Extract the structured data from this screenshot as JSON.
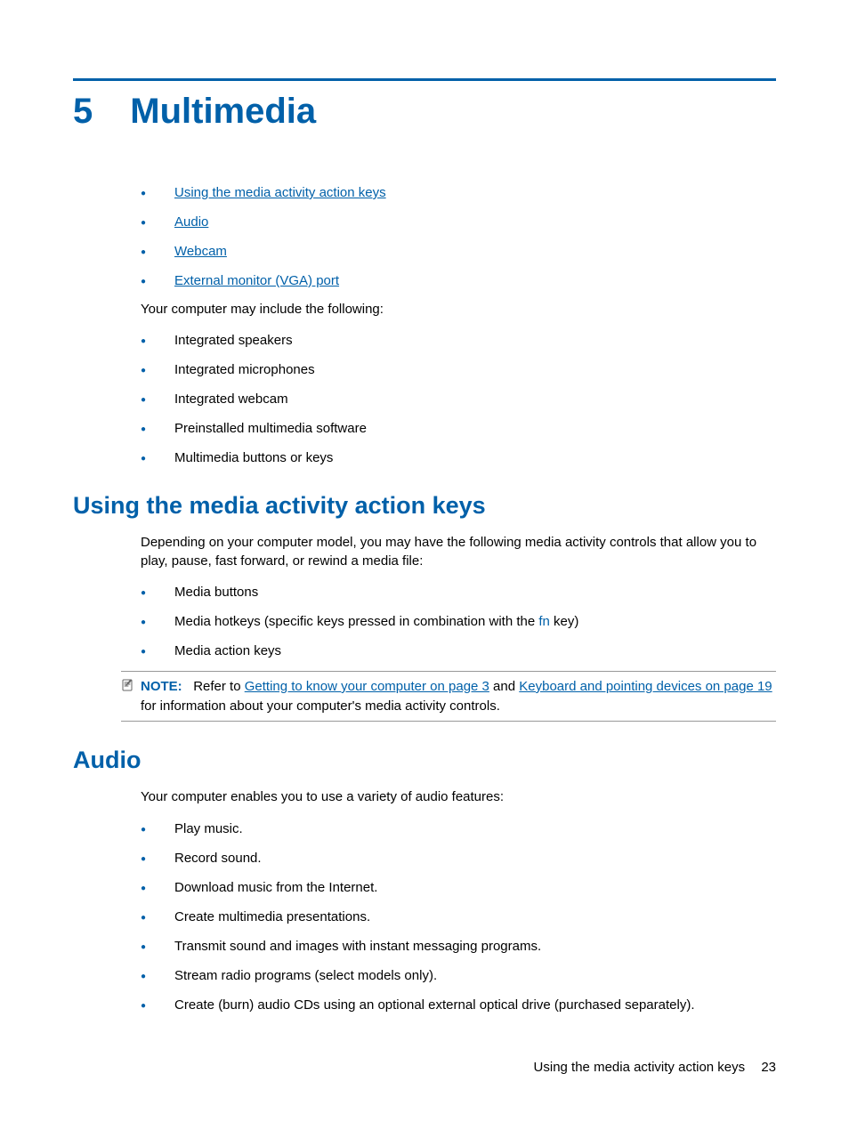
{
  "chapter": {
    "number": "5",
    "title": "Multimedia"
  },
  "toc_links": [
    "Using the media activity action keys",
    "Audio",
    "Webcam",
    "External monitor (VGA) port"
  ],
  "intro_line": "Your computer may include the following:",
  "intro_items": [
    "Integrated speakers",
    "Integrated microphones",
    "Integrated webcam",
    "Preinstalled multimedia software",
    "Multimedia buttons or keys"
  ],
  "section1": {
    "heading": "Using the media activity action keys",
    "para": "Depending on your computer model, you may have the following media activity controls that allow you to play, pause, fast forward, or rewind a media file:",
    "items": {
      "i0": "Media buttons",
      "i1_pre": "Media hotkeys (specific keys pressed in combination with the ",
      "i1_fn": "fn",
      "i1_post": " key)",
      "i2": "Media action keys"
    },
    "note": {
      "label": "NOTE:",
      "pre": "Refer to ",
      "link1": "Getting to know your computer on page 3",
      "mid": " and ",
      "link2": "Keyboard and pointing devices on page 19",
      "post": " for information about your computer's media activity controls."
    }
  },
  "section2": {
    "heading": "Audio",
    "para": "Your computer enables you to use a variety of audio features:",
    "items": [
      "Play music.",
      "Record sound.",
      "Download music from the Internet.",
      "Create multimedia presentations.",
      "Transmit sound and images with instant messaging programs.",
      "Stream radio programs (select models only).",
      "Create (burn) audio CDs using an optional external optical drive (purchased separately)."
    ]
  },
  "footer": {
    "section": "Using the media activity action keys",
    "page": "23"
  }
}
